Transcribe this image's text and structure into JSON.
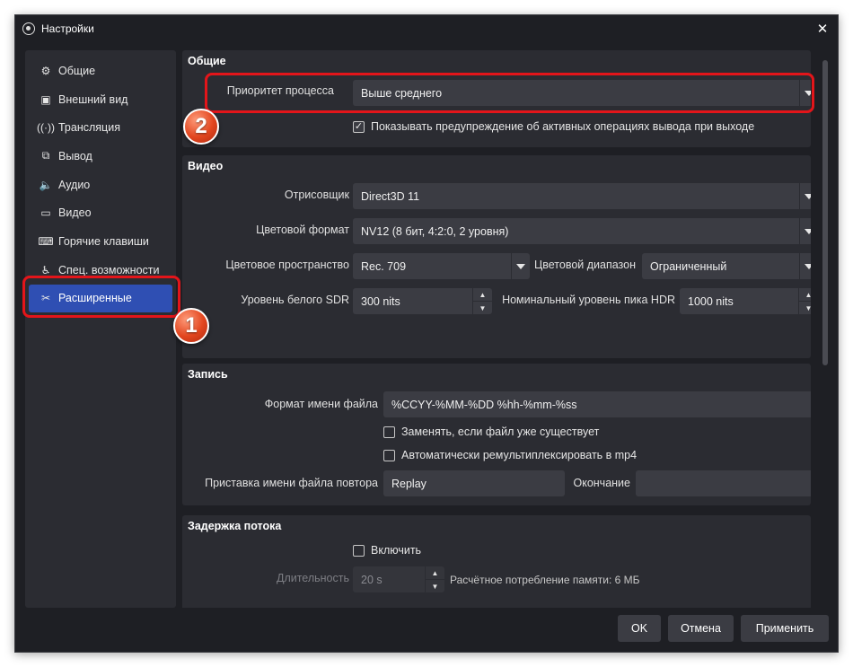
{
  "window": {
    "title": "Настройки",
    "close_icon": "close-icon"
  },
  "sidebar": {
    "items": [
      {
        "label": "Общие",
        "icon": "gear-icon"
      },
      {
        "label": "Внешний вид",
        "icon": "appearance-icon"
      },
      {
        "label": "Трансляция",
        "icon": "broadcast-icon"
      },
      {
        "label": "Вывод",
        "icon": "output-icon"
      },
      {
        "label": "Аудио",
        "icon": "speaker-icon"
      },
      {
        "label": "Видео",
        "icon": "monitor-icon"
      },
      {
        "label": "Горячие клавиши",
        "icon": "keyboard-icon"
      },
      {
        "label": "Спец. возможности",
        "icon": "accessibility-icon"
      },
      {
        "label": "Расширенные",
        "icon": "tools-icon",
        "active": true
      }
    ]
  },
  "general": {
    "title": "Общие",
    "priority_label": "Приоритет процесса",
    "priority_value": "Выше среднего",
    "warn_checkbox_label": "Показывать предупреждение об активных операциях вывода при выходе",
    "warn_checked": true
  },
  "video": {
    "title": "Видео",
    "renderer_label": "Отрисовщик",
    "renderer_value": "Direct3D 11",
    "color_format_label": "Цветовой формат",
    "color_format_value": "NV12 (8 бит, 4:2:0, 2 уровня)",
    "color_space_label": "Цветовое пространство",
    "color_space_value": "Rec. 709",
    "color_range_label": "Цветовой диапазон",
    "color_range_value": "Ограниченный",
    "sdr_white_label": "Уровень белого SDR",
    "sdr_white_value": "300 nits",
    "hdr_peak_label": "Номинальный уровень пика HDR",
    "hdr_peak_value": "1000 nits"
  },
  "recording": {
    "title": "Запись",
    "filename_format_label": "Формат имени файла",
    "filename_format_value": "%CCYY-%MM-%DD %hh-%mm-%ss",
    "overwrite_label": "Заменять, если файл уже существует",
    "overwrite_checked": false,
    "remux_label": "Автоматически ремультиплексировать в mp4",
    "remux_checked": false,
    "replay_prefix_label": "Приставка имени файла повтора",
    "replay_prefix_value": "Replay",
    "suffix_label": "Окончание",
    "suffix_value": ""
  },
  "stream_delay": {
    "title": "Задержка потока",
    "enable_label": "Включить",
    "enable_checked": false,
    "duration_label": "Длительность",
    "duration_value": "20 s",
    "memory_text": "Расчётное потребление памяти: 6 МБ"
  },
  "buttons": {
    "ok": "OK",
    "cancel": "Отмена",
    "apply": "Применить"
  },
  "annotations": {
    "badge_1": "1",
    "badge_2": "2",
    "highlight_color": "#e3151a"
  },
  "colors": {
    "accent": "#2f4fb3",
    "background": "#1e1f24",
    "panel": "#2b2c32",
    "control": "#3b3c43"
  }
}
